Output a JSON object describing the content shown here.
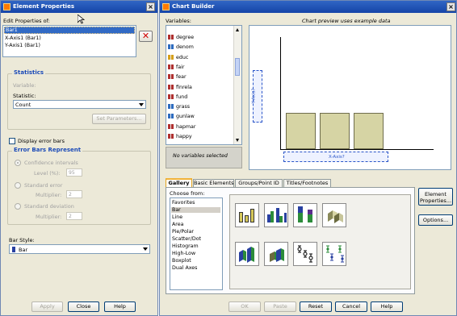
{
  "colors": {
    "title_blue": "#1a4ec0",
    "panel": "#ece9d8",
    "accent_group": "#1c4bb8",
    "bar_fill": "#d6d4a4",
    "close_red": "#c00000"
  },
  "element_properties": {
    "title": "Element Properties",
    "edit_label": "Edit Properties of:",
    "items": [
      "Bar1",
      "X-Axis1 (Bar1)",
      "Y-Axis1 (Bar1)"
    ],
    "statistics_group": "Statistics",
    "variable_label": "Variable:",
    "statistic_label": "Statistic:",
    "statistic_value": "Count",
    "set_params": "Set Parameters...",
    "display_error_bars": "Display error bars",
    "error_group": "Error Bars Represent",
    "ci_label": "Confidence intervals",
    "level_label": "Level (%):",
    "level_value": "95",
    "se_label": "Standard error",
    "se_mult_label": "Multiplier:",
    "se_mult_value": "2",
    "sd_label": "Standard deviation",
    "sd_mult_label": "Multiplier:",
    "sd_mult_value": "2",
    "bar_style_label": "Bar Style:",
    "bar_style_value": "Bar",
    "apply": "Apply",
    "close": "Close",
    "help": "Help"
  },
  "chart_builder": {
    "title": "Chart Builder",
    "variables_label": "Variables:",
    "preview_note": "Chart preview uses example data",
    "variables": [
      "degree",
      "denom",
      "educ",
      "fair",
      "fear",
      "finrela",
      "fund",
      "grass",
      "gunlaw",
      "hapmar",
      "happy"
    ],
    "no_vars": "No variables selected",
    "yaxis": "Y-Axis?",
    "xaxis": "X-Axis?",
    "tabs": [
      "Gallery",
      "Basic Elements",
      "Groups/Point ID",
      "Titles/Footnotes"
    ],
    "choose_from": "Choose from:",
    "chart_types": [
      "Favorites",
      "Bar",
      "Line",
      "Area",
      "Pie/Polar",
      "Scatter/Dot",
      "Histogram",
      "High-Low",
      "Boxplot",
      "Dual Axes"
    ],
    "selected_type": "Bar",
    "element_properties_btn_line1": "Element",
    "element_properties_btn_line2": "Properties...",
    "options_btn": "Options...",
    "ok": "OK",
    "paste": "Paste",
    "reset": "Reset",
    "cancel": "Cancel",
    "help": "Help"
  }
}
